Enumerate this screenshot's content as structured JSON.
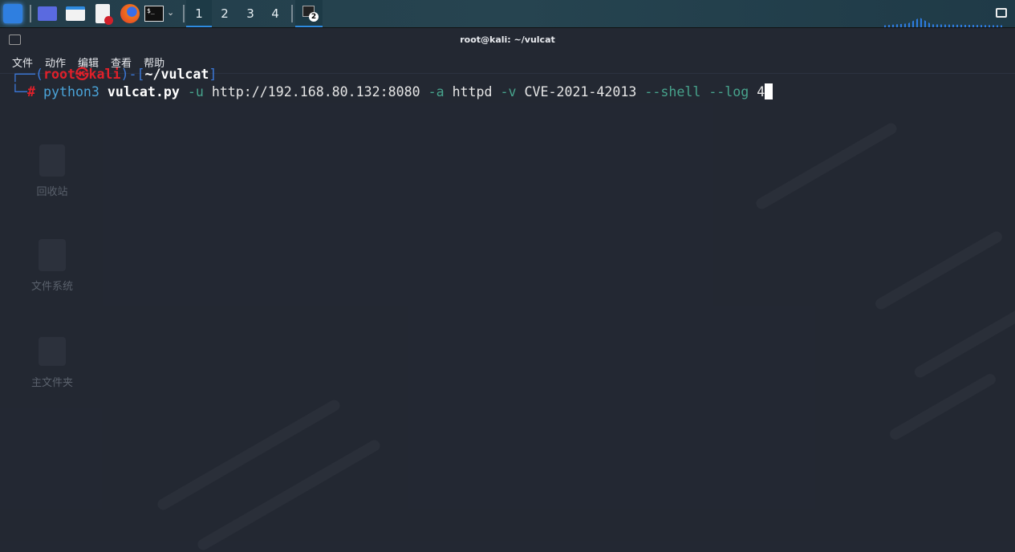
{
  "taskbar": {
    "workspaces": [
      "1",
      "2",
      "3",
      "4"
    ],
    "active_workspace": "1",
    "task_badge": "2"
  },
  "window": {
    "title": "root@kali: ~/vulcat",
    "menu": [
      "文件",
      "动作",
      "编辑",
      "查看",
      "帮助"
    ]
  },
  "desktop": {
    "icons": [
      "回收站",
      "文件系统",
      "主文件夹"
    ]
  },
  "terminal": {
    "user": "root",
    "symbol": "㉿",
    "host": "kali",
    "cwd": "~/vulcat",
    "prompt": "#",
    "cmd": {
      "p1": "python3",
      "script": "vulcat.py",
      "f1": "-u",
      "url": "http://192.168.80.132:8080",
      "f2": "-a",
      "app": "httpd",
      "f3": "-v",
      "cve": "CVE-2021-42013",
      "f4": "--shell",
      "f5": "--log",
      "logv": "4"
    }
  }
}
